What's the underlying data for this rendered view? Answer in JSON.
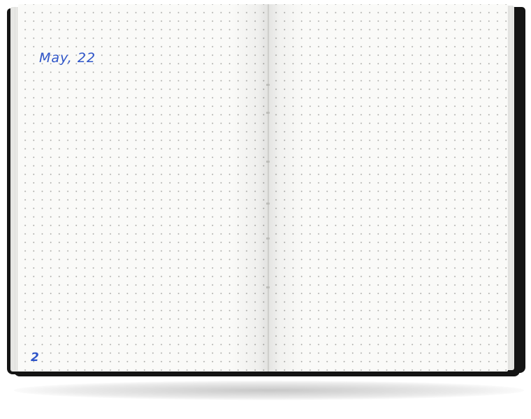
{
  "notebook": {
    "left_page": {
      "date_text": "May, 22",
      "page_number": "2"
    },
    "right_page": {
      "content": ""
    },
    "ink_color": "#2f55c9",
    "cover_color": "#141414",
    "paper_color": "#fafaf8"
  }
}
